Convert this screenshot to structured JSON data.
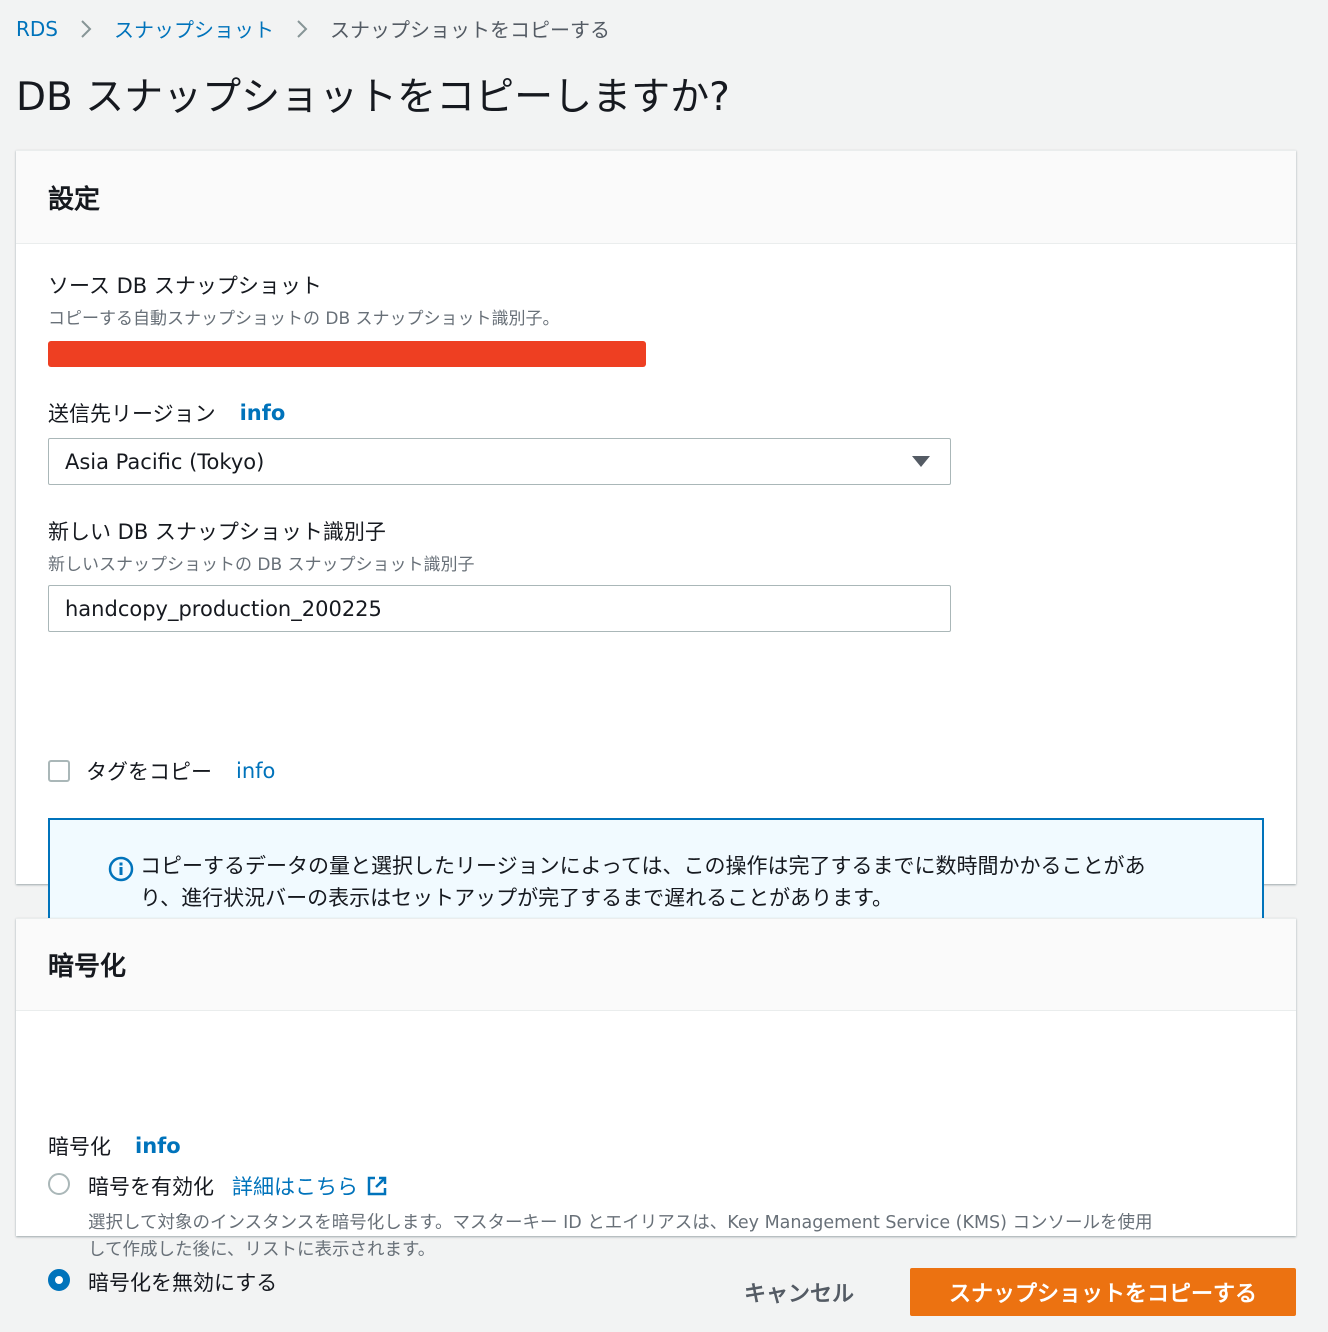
{
  "breadcrumb": {
    "items": [
      "RDS",
      "スナップショット",
      "スナップショットをコピーする"
    ]
  },
  "page": {
    "title": "DB スナップショットをコピーしますか?"
  },
  "settings": {
    "header": "設定",
    "source": {
      "label": "ソース DB スナップショット",
      "description": "コピーする自動スナップショットの DB スナップショット識別子。"
    },
    "region": {
      "label": "送信先リージョン",
      "info": "info",
      "selected": "Asia Pacific (Tokyo)"
    },
    "new_identifier": {
      "label": "新しい DB スナップショット識別子",
      "description": "新しいスナップショットの DB スナップショット識別子",
      "value": "handcopy_production_200225"
    },
    "copy_tags": {
      "label": "タグをコピー",
      "info": "info",
      "checked": false
    },
    "alert": {
      "line1": "コピーするデータの量と選択したリージョンによっては、この操作は完了するまでに数時間かかることがあ",
      "line2": "り、進行状況バーの表示はセットアップが完了するまで遅れることがあります。"
    }
  },
  "encryption": {
    "header": "暗号化",
    "label": "暗号化",
    "info": "info",
    "enable": {
      "label": "暗号を有効化",
      "link": "詳細はこちら",
      "desc_line1": "選択して対象のインスタンスを暗号化します。マスターキー ID とエイリアスは、Key Management Service (KMS) コンソールを使用",
      "desc_line2": "して作成した後に、リストに表示されます。",
      "checked": false
    },
    "disable": {
      "label": "暗号化を無効にする",
      "checked": true
    }
  },
  "footer": {
    "cancel": "キャンセル",
    "submit": "スナップショットをコピーする"
  },
  "colors": {
    "accent": "#0073bb",
    "primary_button": "#ec7211",
    "redaction": "#ee3f22"
  }
}
